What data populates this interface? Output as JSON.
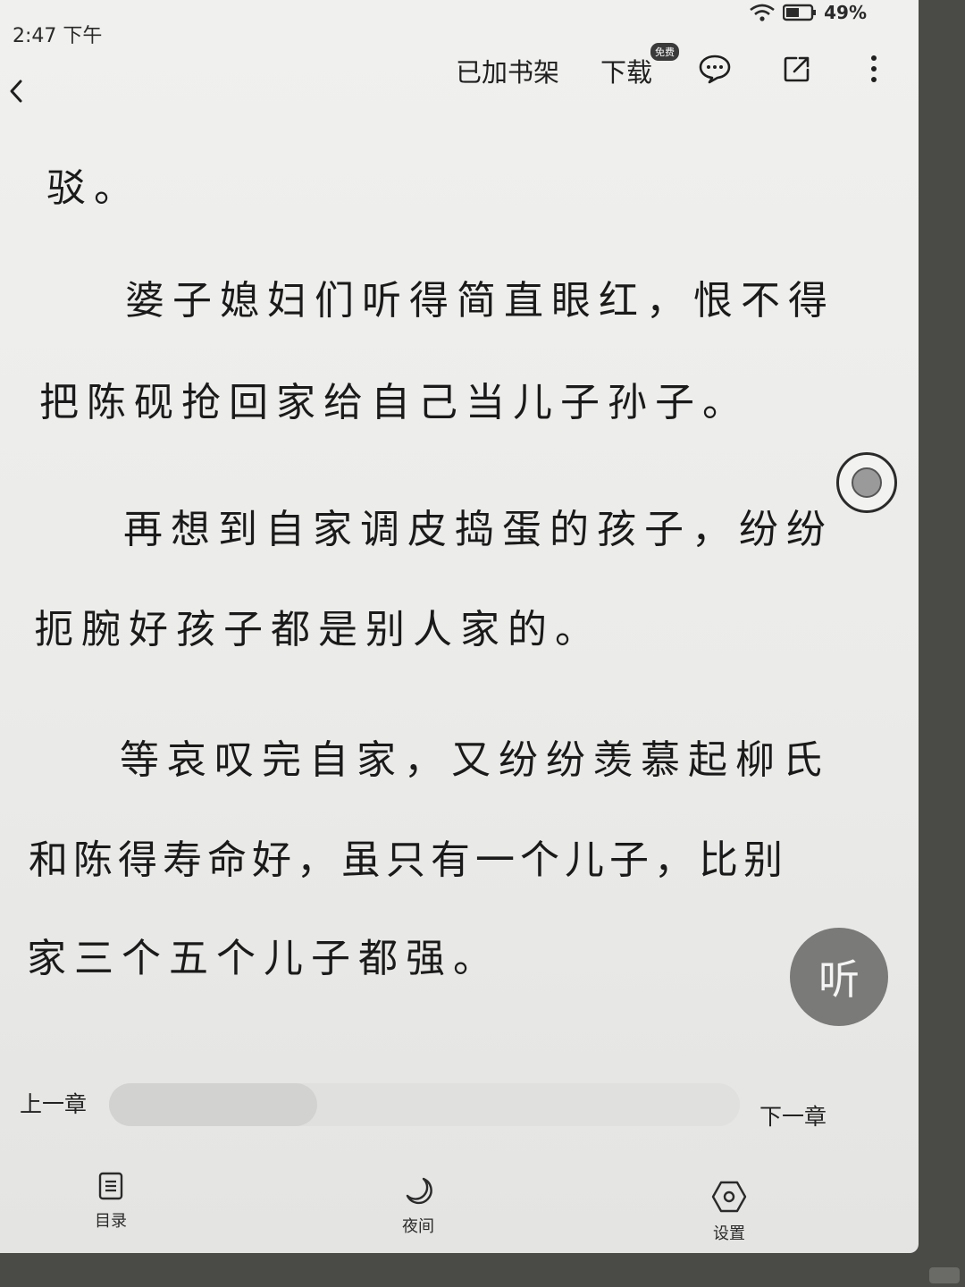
{
  "status_bar": {
    "time": "2:47 下午",
    "battery": "49%",
    "icons": [
      "wifi-icon",
      "battery-icon"
    ]
  },
  "top_bar": {
    "back_icon": "chevron-left-icon",
    "shelf_label": "已加书架",
    "download_label": "下载",
    "download_badge": "免费",
    "comment_icon": "comment-icon",
    "share_icon": "share-icon",
    "more_icon": "more-vertical-icon"
  },
  "content": {
    "lines": [
      "驳。",
      "婆子媳妇们听得简直眼红，恨不得",
      "把陈砚抢回家给自己当儿子孙子。",
      "再想到自家调皮捣蛋的孩子，纷纷",
      "扼腕好孩子都是别人家的。",
      "等哀叹完自家，又纷纷羡慕起柳氏",
      "和陈得寿命好，虽只有一个儿子，比别",
      "家三个五个儿子都强。"
    ]
  },
  "floating": {
    "listen_label": "听",
    "toggle_icon": "record-toggle-icon"
  },
  "chapter_nav": {
    "prev_label": "上一章",
    "next_label": "下一章",
    "progress": 0.33
  },
  "bottom_nav": {
    "toc_label": "目录",
    "toc_icon": "list-icon",
    "night_label": "夜间",
    "night_icon": "moon-icon",
    "settings_label": "设置",
    "settings_icon": "settings-hexagon-icon"
  },
  "colors": {
    "background": "#ecebe9",
    "text": "#1a1a1a",
    "listen_button": "#7a7a78"
  }
}
